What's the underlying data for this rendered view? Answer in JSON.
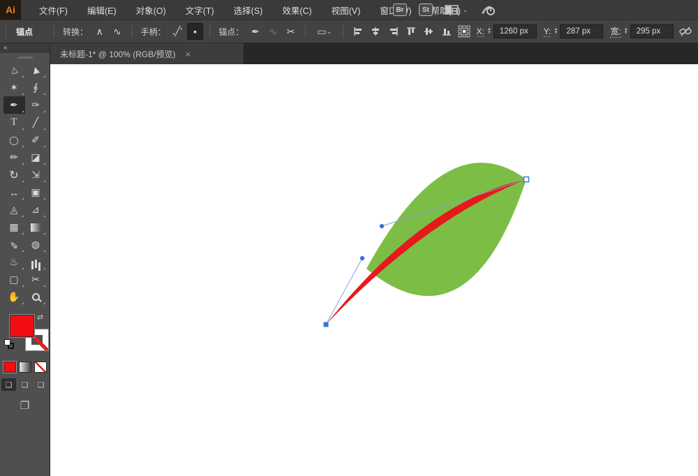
{
  "app": {
    "logo": "Ai",
    "accent_color": "#e8821e"
  },
  "menubar": {
    "items": [
      "文件(F)",
      "编辑(E)",
      "对象(O)",
      "文字(T)",
      "选择(S)",
      "效果(C)",
      "视图(V)",
      "窗口(W)",
      "帮助(H)"
    ],
    "badges": [
      "Br",
      "St"
    ]
  },
  "control_bar": {
    "left_label": "锚点",
    "convert_label": "转换：",
    "handles_label": "手柄：",
    "anchors_label": "锚点：",
    "fields": {
      "x": {
        "label": "X:",
        "value": "1260 px"
      },
      "y": {
        "label": "Y:",
        "value": "287 px"
      },
      "w": {
        "label": "宽:",
        "value": "295 px"
      }
    }
  },
  "document_tab": {
    "title": "未标题-1* @ 100% (RGB/预览)",
    "close": "×"
  },
  "icons": {
    "collapse": "«",
    "convert_corner": "∧",
    "convert_smooth": "∿",
    "handles_show": "╱",
    "handles_hide": "▪",
    "anchor_remove_pen": "✒",
    "anchor_join": "∿",
    "anchor_cut": "✂",
    "artboard_glyph": "▭",
    "chevron_down": "⌄",
    "swap_fill_stroke": "⇄",
    "draw_mode": "❏",
    "screen_mode": "❐"
  },
  "tools": {
    "list": [
      {
        "name": "direct-selection-tool",
        "glyph": "▷"
      },
      {
        "name": "selection-tool",
        "glyph": "▶"
      },
      {
        "name": "magic-wand-tool",
        "glyph": "✶"
      },
      {
        "name": "lasso-tool",
        "glyph": "∮"
      },
      {
        "name": "pen-tool",
        "glyph": "✒"
      },
      {
        "name": "curvature-tool",
        "glyph": "✑"
      },
      {
        "name": "type-tool",
        "glyph": "T"
      },
      {
        "name": "line-segment-tool",
        "glyph": "╱"
      },
      {
        "name": "ellipse-tool",
        "glyph": "◯"
      },
      {
        "name": "paintbrush-tool",
        "glyph": "✐"
      },
      {
        "name": "shaper-tool",
        "glyph": "✏"
      },
      {
        "name": "eraser-tool",
        "glyph": "◪"
      },
      {
        "name": "rotate-tool",
        "glyph": "↻"
      },
      {
        "name": "scale-tool",
        "glyph": "⇲"
      },
      {
        "name": "width-tool",
        "glyph": "↔"
      },
      {
        "name": "free-transform-tool",
        "glyph": "▣"
      },
      {
        "name": "shape-builder-tool",
        "glyph": "◬"
      },
      {
        "name": "perspective-grid-tool",
        "glyph": "⊿"
      },
      {
        "name": "mesh-tool",
        "glyph": "▦"
      },
      {
        "name": "gradient-tool",
        "glyph": ""
      },
      {
        "name": "eyedropper-tool",
        "glyph": "✎"
      },
      {
        "name": "blend-tool",
        "glyph": "◍"
      },
      {
        "name": "symbol-sprayer-tool",
        "glyph": "♨"
      },
      {
        "name": "column-graph-tool",
        "glyph": ""
      },
      {
        "name": "artboard-tool",
        "glyph": "▢"
      },
      {
        "name": "slice-tool",
        "glyph": "✂"
      },
      {
        "name": "hand-tool",
        "glyph": "✋"
      },
      {
        "name": "zoom-tool",
        "glyph": ""
      }
    ]
  },
  "artwork": {
    "description": "green leaf shape with red vein curve, pen-tool bezier handles visible",
    "colors": {
      "leaf_green": "#7cbe45",
      "vein_red": "#e8191c",
      "handle_line": "#7fa3e0",
      "anchor_blue": "#3d71e0"
    }
  },
  "color_controls": {
    "fill": "#f20d12",
    "stroke": "none"
  }
}
